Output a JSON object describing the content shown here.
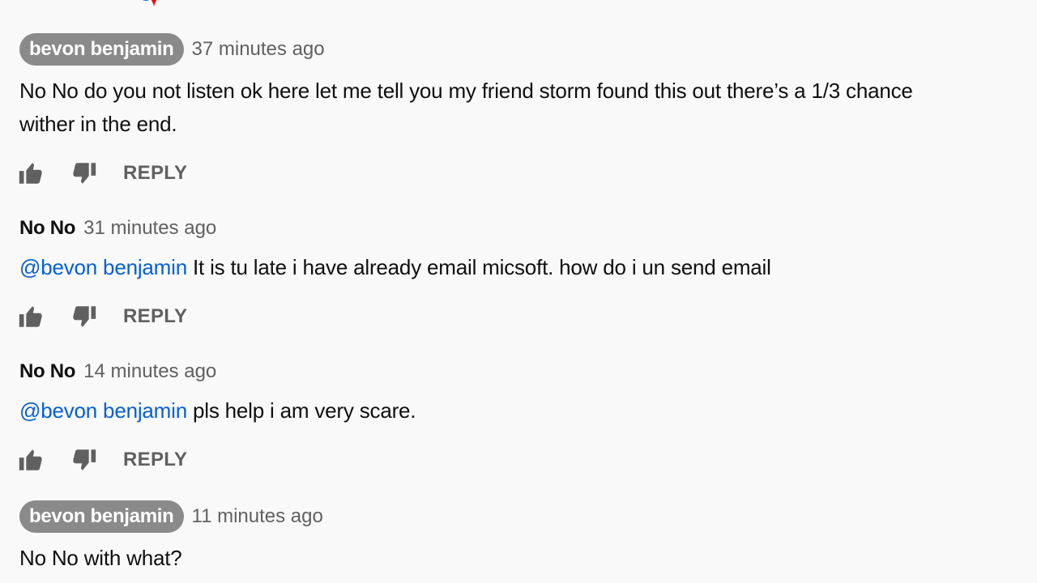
{
  "comments": [
    {
      "author": "bevon benjamin",
      "is_op": true,
      "time": "37 minutes ago",
      "mention": "",
      "lines": [
        "No No do you not listen ok here let me tell you my friend storm found this out there’s a 1/3 chance",
        "wither in the end."
      ],
      "reply_label": "REPLY"
    },
    {
      "author": "No No",
      "is_op": false,
      "time": "31 minutes ago",
      "mention": "@bevon benjamin",
      "text": " It is tu late i have already email micsoft. how do i un send email",
      "reply_label": "REPLY"
    },
    {
      "author": "No No",
      "is_op": false,
      "time": "14 minutes ago",
      "mention": "@bevon benjamin",
      "text": " pls help i am very scare.",
      "reply_label": "REPLY"
    },
    {
      "author": "bevon benjamin",
      "is_op": true,
      "time": "11 minutes ago",
      "text": "No No with what?"
    }
  ],
  "icons": {
    "like": "thumbs-up-icon",
    "dislike": "thumbs-down-icon",
    "heart": "creator-heart-icon"
  },
  "colors": {
    "background": "#f9f9f9",
    "op_badge": "#8a8a8a",
    "mention": "#065fd4",
    "secondary_text": "#606060",
    "heart": "#ff0000",
    "heart_avatar": "#1a73e8"
  }
}
